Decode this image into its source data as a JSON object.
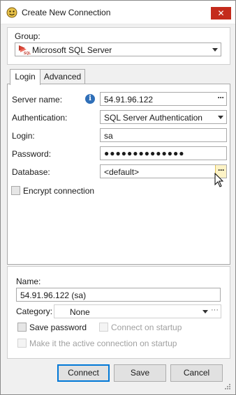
{
  "window": {
    "title": "Create New Connection",
    "close_glyph": "✕"
  },
  "group": {
    "label": "Group:",
    "value": "Microsoft SQL Server",
    "icon": "sql-server-icon"
  },
  "tabs": [
    {
      "label": "Login",
      "active": true
    },
    {
      "label": "Advanced",
      "active": false
    }
  ],
  "login": {
    "server_name_label": "Server name:",
    "server_name_value": "54.91.96.122",
    "authentication_label": "Authentication:",
    "authentication_value": "SQL Server Authentication",
    "login_label": "Login:",
    "login_value": "sa",
    "password_label": "Password:",
    "password_value": "●●●●●●●●●●●●●●",
    "database_label": "Database:",
    "database_value": "<default>",
    "encrypt_label": "Encrypt connection",
    "browse_glyph": "···",
    "info_glyph": "i"
  },
  "connection": {
    "name_label": "Name:",
    "name_value": "54.91.96.122 (sa)",
    "category_label": "Category:",
    "category_value": "None",
    "save_password_label": "Save password",
    "connect_on_startup_label": "Connect on startup",
    "active_on_startup_label": "Make it the active connection on startup"
  },
  "buttons": {
    "connect": "Connect",
    "save": "Save",
    "cancel": "Cancel"
  },
  "colors": {
    "close": "#c42b1c",
    "accent": "#0078d7",
    "info": "#2f6fb8",
    "hover": "#fdf3c6"
  }
}
